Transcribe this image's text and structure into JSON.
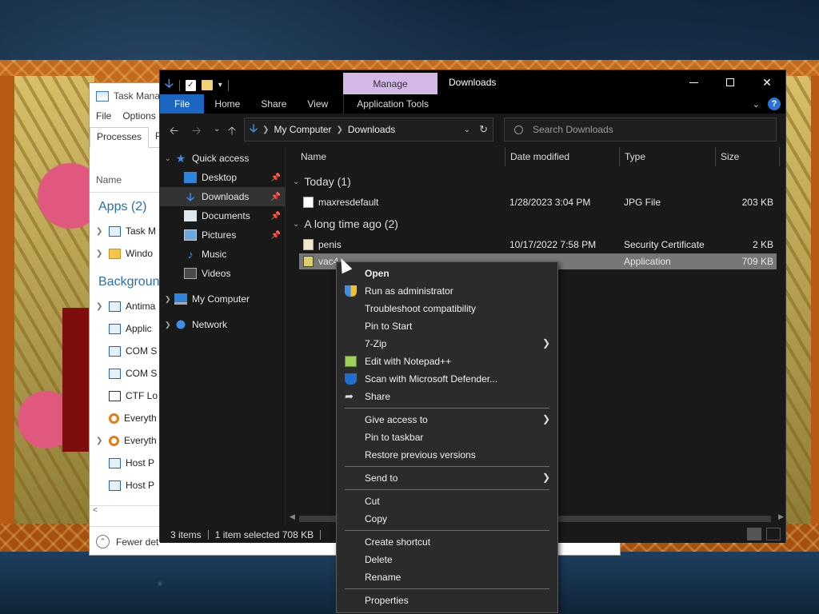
{
  "task_manager": {
    "title": "Task Manag",
    "menu": [
      "File",
      "Options"
    ],
    "tabs": [
      "Processes",
      "Per"
    ],
    "column_name": "Name",
    "apps_header": "Apps (2)",
    "apps": [
      "Task M",
      "Windo"
    ],
    "background_header": "Backgroun",
    "background": [
      "Antima",
      "Applic",
      "COM S",
      "COM S",
      "CTF Lo",
      "Everyth",
      "Everyth",
      "Host P",
      "Host P"
    ],
    "scroll_left": "<",
    "footer": "Fewer det"
  },
  "explorer": {
    "title": "Downloads",
    "manage_tab": "Manage",
    "ribbon_tabs": [
      "File",
      "Home",
      "Share",
      "View",
      "Application Tools"
    ],
    "address": [
      "My Computer",
      "Downloads"
    ],
    "search_placeholder": "Search Downloads",
    "sidebar": [
      {
        "label": "Quick access",
        "icon": "star-icon"
      },
      {
        "label": "Desktop",
        "icon": "desktop-icon",
        "pinned": true
      },
      {
        "label": "Downloads",
        "icon": "downloads-icon",
        "pinned": true,
        "selected": true
      },
      {
        "label": "Documents",
        "icon": "documents-icon",
        "pinned": true
      },
      {
        "label": "Pictures",
        "icon": "pictures-icon",
        "pinned": true
      },
      {
        "label": "Music",
        "icon": "music-icon"
      },
      {
        "label": "Videos",
        "icon": "videos-icon"
      },
      {
        "label": "My Computer",
        "icon": "computer-icon"
      },
      {
        "label": "Network",
        "icon": "network-icon"
      }
    ],
    "columns": [
      "Name",
      "Date modified",
      "Type",
      "Size"
    ],
    "groups": [
      {
        "label": "Today (1)",
        "files": [
          {
            "name": "maxresdefault",
            "date": "1/28/2023 3:04 PM",
            "type": "JPG File",
            "size": "203 KB"
          }
        ]
      },
      {
        "label": "A long time ago (2)",
        "files": [
          {
            "name": "penis",
            "date": "10/17/2022 7:58 PM",
            "type": "Security Certificate",
            "size": "2 KB"
          },
          {
            "name": "vac4",
            "date": "",
            "type": "Application",
            "size": "709 KB",
            "selected": true
          }
        ]
      }
    ],
    "status": {
      "items": "3 items",
      "selected": "1 item selected  708 KB"
    }
  },
  "context_menu": {
    "items": [
      {
        "label": "Open",
        "bold": true
      },
      {
        "label": "Run as administrator",
        "icon": "shield-icon"
      },
      {
        "label": "Troubleshoot compatibility"
      },
      {
        "label": "Pin to Start"
      },
      {
        "label": "7-Zip",
        "submenu": true
      },
      {
        "label": "Edit with Notepad++",
        "icon": "notepad-plus-plus-icon"
      },
      {
        "label": "Scan with Microsoft Defender...",
        "icon": "defender-icon"
      },
      {
        "label": "Share",
        "icon": "share-icon"
      },
      {
        "separator": true
      },
      {
        "label": "Give access to",
        "submenu": true
      },
      {
        "label": "Pin to taskbar"
      },
      {
        "label": "Restore previous versions"
      },
      {
        "separator": true
      },
      {
        "label": "Send to",
        "submenu": true
      },
      {
        "separator": true
      },
      {
        "label": "Cut"
      },
      {
        "label": "Copy"
      },
      {
        "separator": true
      },
      {
        "label": "Create shortcut"
      },
      {
        "label": "Delete"
      },
      {
        "label": "Rename"
      },
      {
        "separator": true
      },
      {
        "label": "Properties"
      }
    ]
  },
  "colors": {
    "accent": "#1a66c2",
    "manage_tab": "#d4b8e8",
    "explorer_bg": "#191919",
    "menu_bg": "#2b2b2b"
  }
}
